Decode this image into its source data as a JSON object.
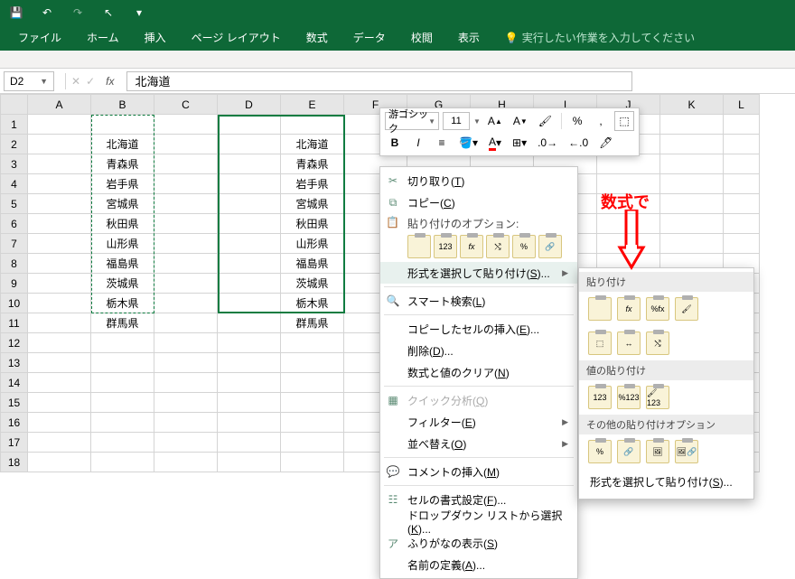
{
  "titlebar": {
    "save_icon": "💾",
    "undo_icon": "↶",
    "redo_icon": "↷",
    "cursor_icon": "↖",
    "more_icon": "▾"
  },
  "tabs": {
    "file": "ファイル",
    "home": "ホーム",
    "insert": "挿入",
    "layout": "ページ レイアウト",
    "formula": "数式",
    "data": "データ",
    "review": "校閲",
    "view": "表示",
    "tellme": "実行したい作業を入力してください"
  },
  "namebox": "D2",
  "formula_value": "北海道",
  "columns": [
    "A",
    "B",
    "C",
    "D",
    "E",
    "F",
    "G",
    "H",
    "I",
    "J",
    "K",
    "L"
  ],
  "rows_b": [
    "北海道",
    "青森県",
    "岩手県",
    "宮城県",
    "秋田県",
    "山形県",
    "福島県",
    "茨城県",
    "栃木県",
    "群馬県"
  ],
  "rows_e": [
    "北海道",
    "青森県",
    "岩手県",
    "宮城県",
    "秋田県",
    "山形県",
    "福島県",
    "茨城県",
    "栃木県",
    "群馬県"
  ],
  "mini": {
    "font": "游ゴシック",
    "size": "11",
    "bold": "B",
    "italic": "I"
  },
  "ctx": {
    "cut": "切り取り",
    "cut_accel": "T",
    "copy": "コピー",
    "copy_accel": "C",
    "paste_options": "貼り付けのオプション:",
    "paste_special": "形式を選択して貼り付け",
    "paste_special_accel": "S",
    "smart_lookup": "スマート検索",
    "smart_lookup_accel": "L",
    "insert_copied": "コピーしたセルの挿入",
    "insert_copied_accel": "E",
    "delete": "削除",
    "delete_accel": "D",
    "clear": "数式と値のクリア",
    "clear_accel": "N",
    "quick_analysis": "クイック分析",
    "quick_analysis_accel": "Q",
    "filter": "フィルター",
    "filter_accel": "E",
    "sort": "並べ替え",
    "sort_accel": "O",
    "insert_comment": "コメントの挿入",
    "insert_comment_accel": "M",
    "format_cells": "セルの書式設定",
    "format_cells_accel": "F",
    "dropdown": "ドロップダウン リストから選択",
    "dropdown_accel": "K",
    "furigana": "ふりがなの表示",
    "furigana_accel": "S",
    "define_name": "名前の定義",
    "define_name_accel": "A"
  },
  "paste_sub": {
    "paste": "貼り付け",
    "values": "値の貼り付け",
    "other": "その他の貼り付けオプション",
    "special": "形式を選択して貼り付け",
    "special_accel": "S"
  },
  "annotation": "数式で"
}
